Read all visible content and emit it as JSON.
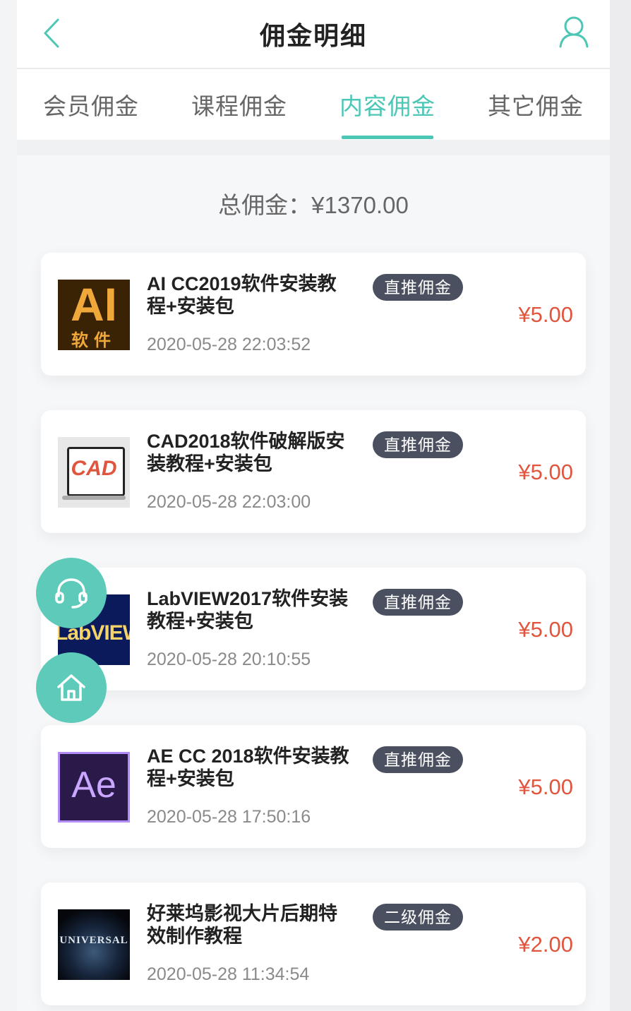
{
  "header": {
    "title": "佣金明细"
  },
  "tabs": [
    {
      "label": "会员佣金",
      "active": false
    },
    {
      "label": "课程佣金",
      "active": false
    },
    {
      "label": "内容佣金",
      "active": true
    },
    {
      "label": "其它佣金",
      "active": false
    }
  ],
  "summary": {
    "total": "总佣金：¥1370.00"
  },
  "items": [
    {
      "thumb_icon": "ai-software-thumbnail",
      "thumb_text": "AI",
      "thumb_sub": "软件",
      "name_line1": "AI CC2019软件安装教",
      "name_line2": "程+安装包",
      "badge": "直推佣金",
      "time": "2020-05-28 22:03:52",
      "amount": "¥5.00"
    },
    {
      "thumb_icon": "cad-software-thumbnail",
      "thumb_text": "CAD",
      "name_line1": "CAD2018软件破解版安",
      "name_line2": "装教程+安装包",
      "badge": "直推佣金",
      "time": "2020-05-28 22:03:00",
      "amount": "¥5.00"
    },
    {
      "thumb_icon": "labview-software-thumbnail",
      "thumb_text": "LabVIEW",
      "name_line1": "LabVIEW2017软件安装",
      "name_line2": "教程+安装包",
      "badge": "直推佣金",
      "time": "2020-05-28 20:10:55",
      "amount": "¥5.00"
    },
    {
      "thumb_icon": "ae-software-thumbnail",
      "thumb_text": "Ae",
      "name_line1": "AE CC 2018软件安装教",
      "name_line2": "程+安装包",
      "badge": "直推佣金",
      "time": "2020-05-28 17:50:16",
      "amount": "¥5.00"
    },
    {
      "thumb_icon": "universal-logo-thumbnail",
      "thumb_text": "UNIVERSAL",
      "name_line1": "好莱坞影视大片后期特",
      "name_line2": "效制作教程",
      "badge": "二级佣金",
      "time": "2020-05-28 11:34:54",
      "amount": "¥2.00"
    }
  ],
  "floating": {
    "service_icon": "headset-icon",
    "home_icon": "home-icon"
  },
  "colors": {
    "accent": "#4cc7b5",
    "amount": "#e0553d",
    "badge_bg": "#4a5060",
    "float_bg": "#5ecab9"
  }
}
